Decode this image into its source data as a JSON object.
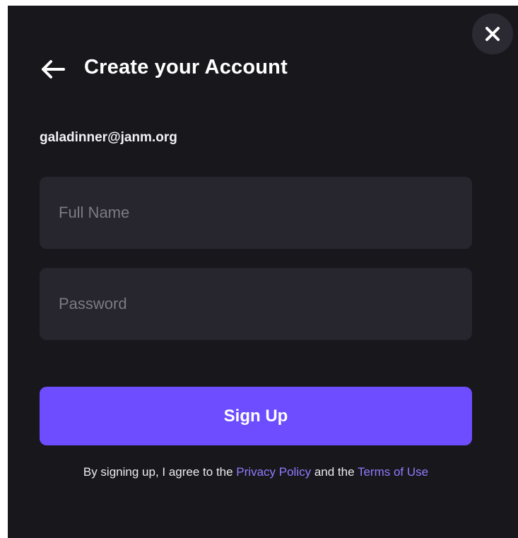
{
  "dialog": {
    "title": "Create your Account",
    "email": "galadinner@janm.org",
    "close_icon": "close-icon",
    "back_icon": "arrow-left-icon"
  },
  "form": {
    "full_name": {
      "value": "",
      "placeholder": "Full Name"
    },
    "password": {
      "value": "",
      "placeholder": "Password"
    },
    "submit_label": "Sign Up"
  },
  "legal": {
    "prefix": "By signing up, I agree to the ",
    "privacy_link": "Privacy Policy",
    "middle": " and the ",
    "terms_link": "Terms of Use"
  },
  "colors": {
    "background": "#18171c",
    "input_background": "#27262e",
    "accent": "#6d4dff",
    "link": "#8f7bff",
    "close_button_background": "#2b2a32"
  }
}
